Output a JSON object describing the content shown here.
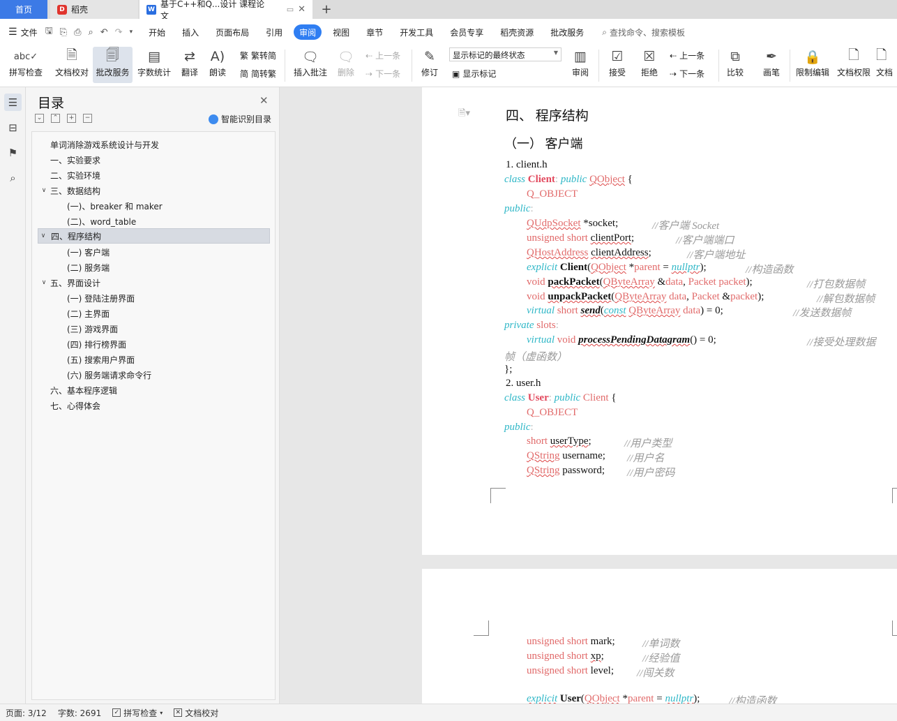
{
  "tabs": {
    "home": "首页",
    "daoke": "稻壳",
    "doc": "基于C++和Q...设计 课程论文",
    "logo_doc": "W"
  },
  "menu": {
    "file": "文件",
    "items": [
      "开始",
      "插入",
      "页面布局",
      "引用",
      "审阅",
      "视图",
      "章节",
      "开发工具",
      "会员专享",
      "稻壳资源",
      "批改服务"
    ],
    "search": "查找命令、搜索模板"
  },
  "ribbon": {
    "spell": "拼写检查",
    "doc_check": "文档校对",
    "correction": "批改服务",
    "word_count": "字数统计",
    "translate": "翻译",
    "read": "朗读",
    "trad": "繁转简",
    "simp": "简转繁",
    "insert_comment": "插入批注",
    "delete": "删除",
    "prev": "上一条",
    "next": "下一条",
    "revise": "修订",
    "markup_state": "显示标记的最终状态",
    "show_markup": "显示标记",
    "review": "审阅",
    "accept": "接受",
    "reject": "拒绝",
    "prev2": "上一条",
    "next2": "下一条",
    "compare": "比较",
    "pen": "画笔",
    "restrict": "限制编辑",
    "rights": "文档权限",
    "doc_more": "文档"
  },
  "toc": {
    "title": "目录",
    "smart": "智能识别目录",
    "items": [
      "单词消除游戏系统设计与开发",
      "一、实验要求",
      "二、实验环境",
      "三、数据结构",
      "(一)、breaker 和 maker",
      "(二)、word_table",
      "四、程序结构",
      "(一) 客户端",
      "(二) 服务端",
      "五、界面设计",
      "(一) 登陆注册界面",
      "(二) 主界面",
      "(三) 游戏界面",
      "(四) 排行榜界面",
      "(五) 搜索用户界面",
      "(六) 服务端请求命令行",
      "六、基本程序逻辑",
      "七、心得体会"
    ]
  },
  "doc": {
    "h1": "四、 程序结构",
    "h2": "（一）  客户端",
    "p1_title": "1.   client.h",
    "p2_title": "2.   user.h",
    "kw_class": "class",
    "kw_public": "public",
    "kw_private": "private",
    "kw_slots": "slots",
    "kw_explicit": "explicit",
    "kw_virtual": "virtual",
    "kw_const": "const",
    "kw_void": "void",
    "kw_short": "short",
    "kw_unsigned_short": "unsigned short",
    "client": "Client",
    "user": "User",
    "qobject": "QObject",
    "q_object": "Q_OBJECT",
    "qudpsocket": "QUdpSocket",
    "qhostaddress": "QHostAddress",
    "qbytearray": "QByteArray",
    "qstring": "QString",
    "packet": "Packet",
    "socket": "*socket;",
    "clientPort": "clientPort",
    "clientAddress": "clientAddress",
    "parent": "parent",
    "nullptr": "nullptr",
    "data": "data",
    "packet_var": "packet",
    "packPacket": "packPacket",
    "unpackPacket": "unpackPacket",
    "send": "send",
    "processPending": "processPendingDatagram",
    "userType": "userType",
    "username": "username;",
    "password": "password;",
    "mark": "mark;",
    "xp": "xp",
    "level": "level;",
    "c_socket": "//客户端 Socket",
    "c_port": "//客户端端口",
    "c_addr": "//客户端地址",
    "c_ctor": "//构造函数",
    "c_pack": "//打包数据帧",
    "c_unpack": "//解包数据帧",
    "c_send": "//发送数据帧",
    "c_recv": "//接受处理数据",
    "c_recv2": "帧（虚函数）",
    "c_usertype": "//用户类型",
    "c_username": "//用户名",
    "c_password": "//用户密码",
    "c_mark": "//单词数",
    "c_xp": "//经验值",
    "c_level": "//闯关数",
    "close_brace": "};"
  },
  "status": {
    "page": "页面: 3/12",
    "words": "字数: 2691",
    "spell": "拼写检查",
    "check": "文档校对"
  },
  "colors": {
    "accent": "#2f7ef2",
    "keyword": "#2fb7c7",
    "type": "#e16a6a"
  }
}
